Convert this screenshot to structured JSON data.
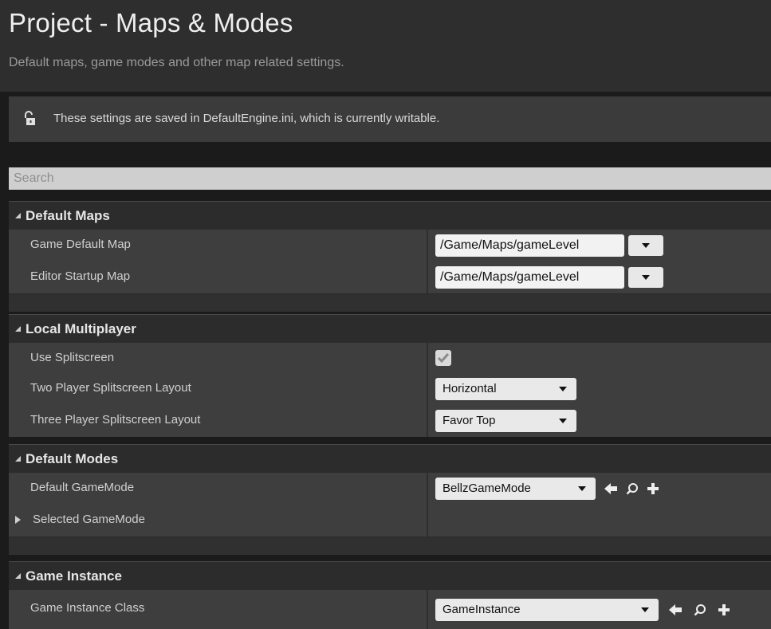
{
  "header": {
    "title": "Project - Maps & Modes",
    "subtitle": "Default maps, game modes and other map related settings."
  },
  "notice": {
    "icon": "lock-icon",
    "text": "These settings are saved in DefaultEngine.ini, which is currently writable."
  },
  "search": {
    "placeholder": "Search",
    "value": ""
  },
  "categories": {
    "default_maps": {
      "title": "Default Maps",
      "rows": [
        {
          "label": "Game Default Map",
          "value": "/Game/Maps/gameLevel"
        },
        {
          "label": "Editor Startup Map",
          "value": "/Game/Maps/gameLevel"
        }
      ]
    },
    "local_multiplayer": {
      "title": "Local Multiplayer",
      "use_splitscreen": {
        "label": "Use Splitscreen",
        "checked": true
      },
      "two_player": {
        "label": "Two Player Splitscreen Layout",
        "value": "Horizontal"
      },
      "three_player": {
        "label": "Three Player Splitscreen Layout",
        "value": "Favor Top"
      }
    },
    "default_modes": {
      "title": "Default Modes",
      "default_gamemode": {
        "label": "Default GameMode",
        "value": "BellzGameMode"
      },
      "selected_gamemode": {
        "label": "Selected GameMode",
        "expanded": false
      }
    },
    "game_instance": {
      "title": "Game Instance",
      "class": {
        "label": "Game Instance Class",
        "value": "GameInstance"
      }
    }
  },
  "icons": {
    "use_selected": "arrow-left-icon",
    "browse": "search-icon",
    "new": "plus-icon",
    "dropdown": "chevron-down-icon",
    "check": "checkmark-icon"
  },
  "colors": {
    "panel_bg": "#3e3e3e",
    "header_bg": "#2e2e2e",
    "text": "#d0d0d0"
  }
}
